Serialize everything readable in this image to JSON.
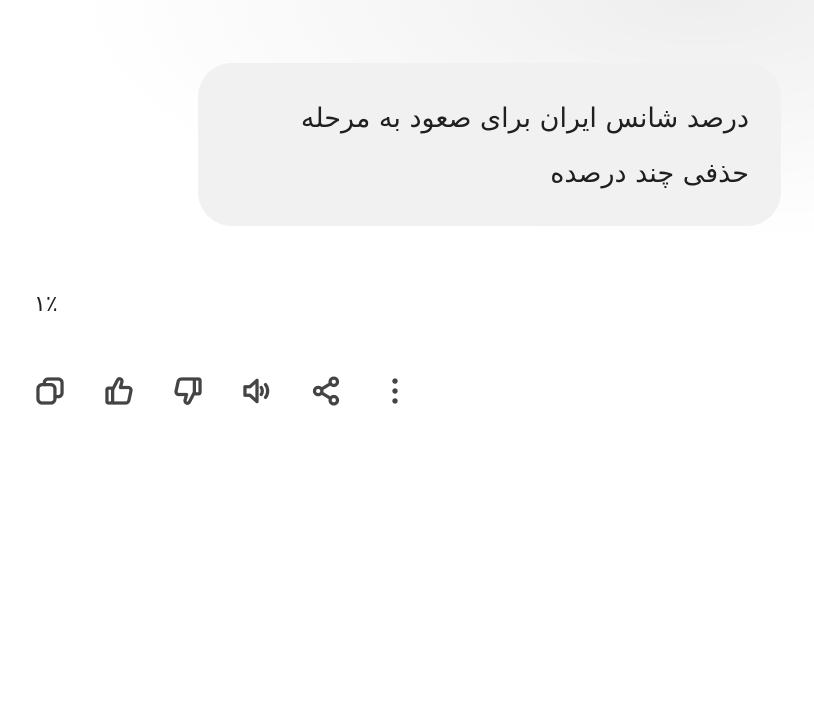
{
  "conversation": {
    "user_message": {
      "line_1": "درصد شانس ایران برای صعود به مرحله",
      "line_2": "حذفی چند درصده"
    },
    "response": {
      "text": "۱٪"
    }
  },
  "actions": [
    {
      "name": "copy",
      "icon": "copy-icon"
    },
    {
      "name": "like",
      "icon": "thumbs-up-icon"
    },
    {
      "name": "dislike",
      "icon": "thumbs-down-icon"
    },
    {
      "name": "read-aloud",
      "icon": "speaker-icon"
    },
    {
      "name": "share",
      "icon": "share-icon"
    },
    {
      "name": "more",
      "icon": "more-vertical-icon"
    }
  ],
  "colors": {
    "bubble_background": "#f1f1f1",
    "text": "#1f1f1f",
    "icon": "#444444",
    "background": "#ffffff"
  }
}
